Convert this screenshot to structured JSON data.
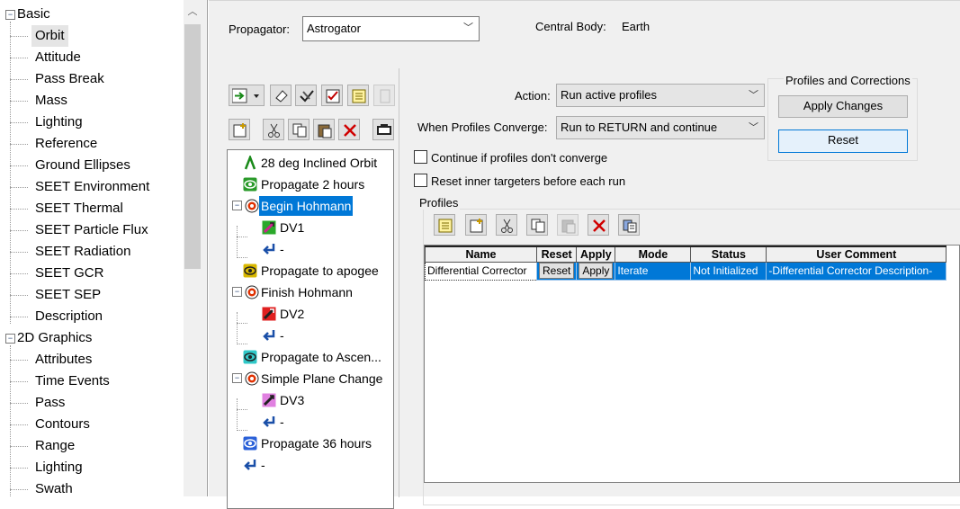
{
  "nav_tree": {
    "groups": [
      {
        "label": "Basic",
        "items": [
          "Orbit",
          "Attitude",
          "Pass Break",
          "Mass",
          "Lighting",
          "Reference",
          "Ground Ellipses",
          "SEET Environment",
          "SEET Thermal",
          "SEET Particle Flux",
          "SEET Radiation",
          "SEET GCR",
          "SEET SEP",
          "Description"
        ],
        "selected": "Orbit"
      },
      {
        "label": "2D Graphics",
        "items": [
          "Attributes",
          "Time Events",
          "Pass",
          "Contours",
          "Range",
          "Lighting",
          "Swath"
        ]
      }
    ]
  },
  "propagator": {
    "label": "Propagator:",
    "value": "Astrogator"
  },
  "central_body": {
    "label": "Central Body:",
    "value": "Earth"
  },
  "sequence": [
    {
      "label": "28 deg Inclined Orbit",
      "icon": "initial-state-icon",
      "level": 0
    },
    {
      "label": "Propagate 2 hours",
      "icon": "propagate-icon",
      "level": 0
    },
    {
      "label": "Begin Hohmann",
      "icon": "target-sequence-icon",
      "level": 0,
      "expanded": true,
      "selected": true
    },
    {
      "label": "DV1",
      "icon": "maneuver-icon",
      "level": 1
    },
    {
      "label": "-",
      "icon": "return-icon",
      "level": 1
    },
    {
      "label": "Propagate to apogee",
      "icon": "propagate-icon",
      "level": 0
    },
    {
      "label": "Finish Hohmann",
      "icon": "target-sequence-icon",
      "level": 0,
      "expanded": true
    },
    {
      "label": "DV2",
      "icon": "maneuver-icon",
      "level": 1
    },
    {
      "label": "-",
      "icon": "return-icon",
      "level": 1
    },
    {
      "label": "Propagate to Ascen...",
      "icon": "propagate-icon",
      "level": 0
    },
    {
      "label": "Simple Plane Change",
      "icon": "target-sequence-icon",
      "level": 0,
      "expanded": true
    },
    {
      "label": "DV3",
      "icon": "maneuver-icon",
      "level": 1
    },
    {
      "label": "-",
      "icon": "return-icon",
      "level": 1
    },
    {
      "label": "Propagate 36 hours",
      "icon": "propagate-icon",
      "level": 0
    },
    {
      "label": "-",
      "icon": "return-icon",
      "level": 0
    }
  ],
  "target": {
    "action_label": "Action:",
    "action_value": "Run active profiles",
    "converge_label": "When Profiles Converge:",
    "converge_value": "Run to RETURN and continue",
    "continue_label": "Continue if profiles don't converge",
    "reset_label": "Reset inner targeters before each run"
  },
  "corrections": {
    "title": "Profiles and Corrections",
    "apply_label": "Apply Changes",
    "reset_label": "Reset"
  },
  "profiles": {
    "title": "Profiles",
    "columns": [
      "Name",
      "Reset",
      "Apply",
      "Mode",
      "Status",
      "User Comment"
    ],
    "rows": [
      {
        "name": "Differential Corrector",
        "reset": "Reset",
        "apply": "Apply",
        "mode": "Iterate",
        "status": "Not Initialized",
        "comment": "-Differential Corrector Description-"
      }
    ]
  },
  "colors": {
    "selection": "#0078d7",
    "panel": "#f0f0f0"
  }
}
